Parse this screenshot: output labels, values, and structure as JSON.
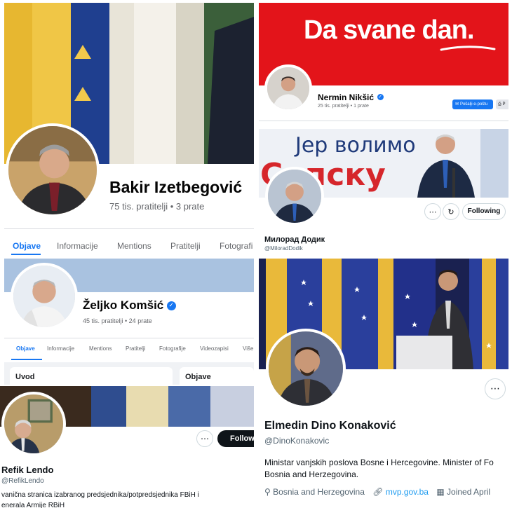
{
  "bakir": {
    "name": "Bakir Izetbegović",
    "stats": "75 tis. pratitelji • 3 prate",
    "tabs": [
      "Objave",
      "Informacije",
      "Mentions",
      "Pratitelji",
      "Fotografi"
    ]
  },
  "zeljko": {
    "name": "Željko Komšić",
    "stats": "45 tis. pratitelji • 24 prate",
    "tabs": [
      "Objave",
      "Informacije",
      "Mentions",
      "Pratitelji",
      "Fotografije",
      "Videozapisi",
      "Više"
    ],
    "cards": [
      "Uvod",
      "Objave"
    ]
  },
  "refik": {
    "name": "Refik Lendo",
    "handle": "@RefikLendo",
    "bio_line1": "vanična stranica izabranog predsjednika/potpredsjednika FBiH i",
    "bio_line2": "enerala Armije RBiH",
    "follow_label": "Follow"
  },
  "niksic": {
    "banner_text": "Da svane dan.",
    "name": "Nermin Nikšić",
    "stats": "25 tis. pratitelji • 1 prate",
    "email_button": "Pošalji e-poštu",
    "print_glyph": "P"
  },
  "dodik": {
    "banner_text": "Јер волимо",
    "banner_text2": "Српску",
    "name": "Милорад Додик",
    "handle": "@MiloradDodik",
    "following_label": "Following"
  },
  "konakovic": {
    "name": "Elmedin Dino Konaković",
    "handle": "@DinoKonakovic",
    "bio_line1": "Ministar vanjskih poslova Bosne i Hercegovine. Minister of Fo",
    "bio_line2": "Bosnia and Herzegovina.",
    "location": "Bosnia and Herzegovina",
    "website": "mvp.gov.ba",
    "joined": "Joined April"
  },
  "colors": {
    "facebook_blue": "#1877f2",
    "red_banner": "#e3141a",
    "twitter_link": "#1d9bf0"
  }
}
